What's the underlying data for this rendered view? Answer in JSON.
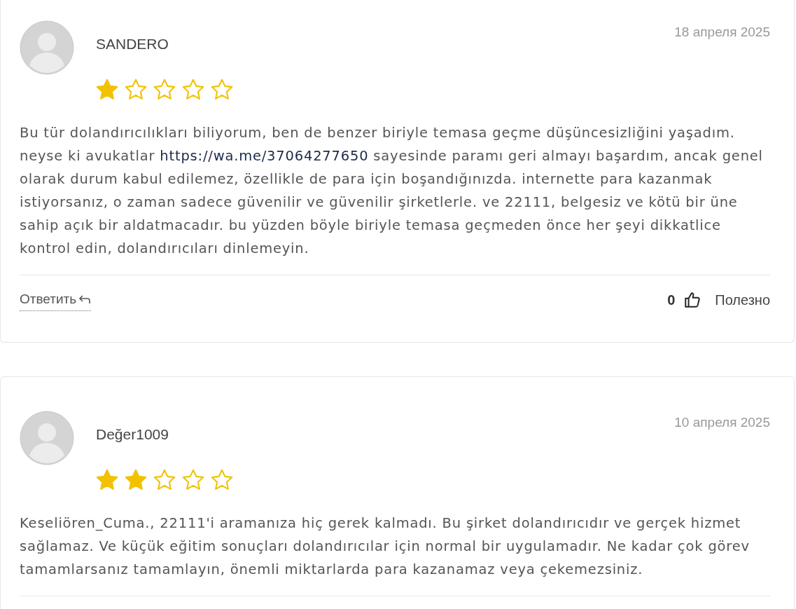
{
  "reviews": [
    {
      "author": "SANDERO",
      "date": "18 апреля 2025",
      "stars": 1,
      "body": [
        {
          "kind": "text",
          "text": "Bu tür dolandırıcılıkları biliyorum, ben de benzer biriyle temasa geçme düşüncesizliğini yaşadım. neyse ki avukatlar "
        },
        {
          "kind": "link",
          "text": "https://wa.me/37064277650"
        },
        {
          "kind": "text",
          "text": " sayesinde paramı geri almayı başardım, ancak genel olarak durum kabul edilemez, özellikle de para için boşandığınızda. internette para kazanmak istiyorsanız, o zaman sadece güvenilir ve güvenilir şirketlerle. ve 22111, belgesiz ve kötü bir üne sahip açık bir aldatmacadır. bu yüzden böyle biriyle temasa geçmeden önce her şeyi dikkatlice kontrol edin, dolandırıcıları dinlemeyin."
        }
      ],
      "footer": {
        "reply": "Ответить",
        "count": "0",
        "helpful": "Полезно"
      }
    },
    {
      "author": "Değer1009",
      "date": "10 апреля 2025",
      "stars": 2,
      "body": [
        {
          "kind": "text",
          "text": "Keseliören_Cuma., 22111'i aramanıza hiç gerek kalmadı. Bu şirket dolandırıcıdır ve gerçek hizmet sağlamaz. Ve küçük eğitim sonuçları dolandırıcılar için normal bir uygulamadır. Ne kadar çok görev tamamlarsanız tamamlayın, önemli miktarlarda para kazanamaz veya çekemezsiniz."
        }
      ]
    }
  ]
}
